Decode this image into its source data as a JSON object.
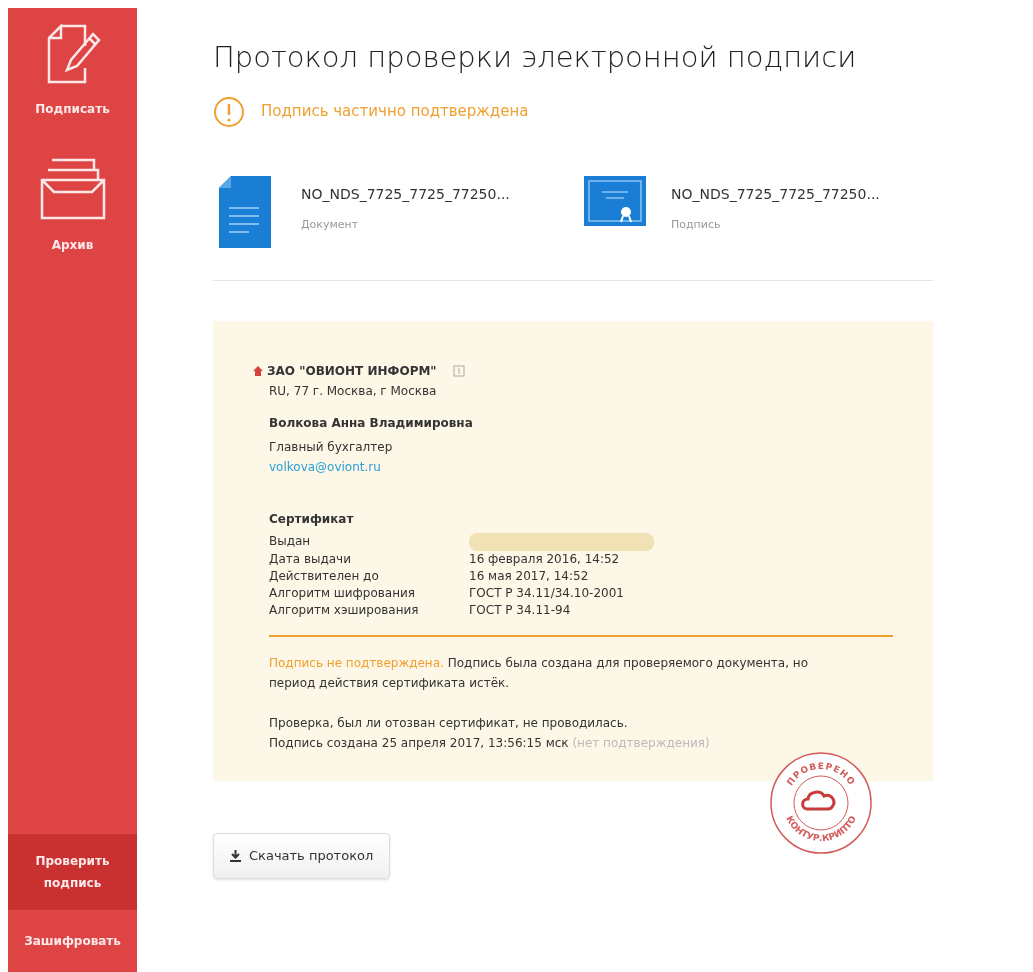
{
  "sidebar": {
    "items": [
      {
        "label": "Подписать",
        "kind": "sign",
        "selected": false
      },
      {
        "label": "Архив",
        "kind": "archive",
        "selected": false
      }
    ],
    "bottom_items": [
      {
        "label": "Проверить подпись",
        "selected": true
      },
      {
        "label": "Зашифровать",
        "selected": false
      }
    ]
  },
  "title": "Протокол проверки электронной подписи",
  "status": {
    "text": "Подпись частично подтверждена",
    "kind": "partial"
  },
  "files": [
    {
      "kind": "document",
      "name": "NO_NDS_7725_7725_77250...",
      "type": "Документ"
    },
    {
      "kind": "signature",
      "name": "NO_NDS_7725_7725_77250...",
      "type": "Подпись"
    }
  ],
  "signer": {
    "organization": "ЗАО \"ОВИОНТ ИНФОРМ\"",
    "address": "RU, 77 г. Москва, г Москва",
    "person": "Волкова Анна Владимировна",
    "position": "Главный бухгалтер",
    "email": "volkova@oviont.ru"
  },
  "certificate": {
    "heading": "Сертификат",
    "rows": [
      {
        "label": "Выдан",
        "redacted": true
      },
      {
        "label": "Дата выдачи",
        "value": "16 февраля 2016, 14:52",
        "redacted": false
      },
      {
        "label": "Действителен до",
        "value": "16 мая 2017, 14:52",
        "redacted": false
      },
      {
        "label": "Алгоритм шифрования",
        "value": "ГОСТ Р 34.11/34.10-2001",
        "redacted": false
      },
      {
        "label": "Алгоритм хэширования",
        "value": "ГОСТ Р 34.11-94",
        "redacted": false
      }
    ]
  },
  "result": {
    "warning": "Подпись не подтверждена.",
    "text": "Подпись была создана для проверяемого документа, но период действия сертификата истёк."
  },
  "revocation_note": "Проверка, был ли отозван сертификат, не проводилась.",
  "signed_at": {
    "text": "Подпись создана 25 апреля 2017, 13:56:15 мск",
    "note": "(нет подтверждения)"
  },
  "stamp": {
    "top": "ПРОВЕРЕНО",
    "bottom": "КОНТУР.КРИПТО"
  },
  "download_button": "Скачать протокол"
}
